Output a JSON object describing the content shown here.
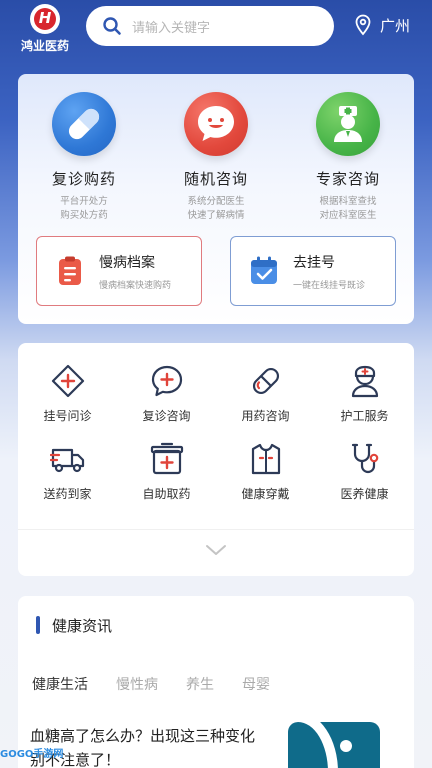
{
  "header": {
    "logo_text": "鸿业医药",
    "search_placeholder": "请输入关键字",
    "city": "广州"
  },
  "services": [
    {
      "title": "复诊购药",
      "sub1": "平台开处方",
      "sub2": "购买处方药",
      "icon": "pill-icon",
      "color": "#2f78d6"
    },
    {
      "title": "随机咨询",
      "sub1": "系统分配医生",
      "sub2": "快速了解病情",
      "icon": "chat-smile-icon",
      "color": "#e2483c"
    },
    {
      "title": "专家咨询",
      "sub1": "根据科室查找",
      "sub2": "对应科室医生",
      "icon": "doctor-icon",
      "color": "#47b448"
    }
  ],
  "quick": [
    {
      "title": "慢病档案",
      "sub": "慢病档案快速购药",
      "icon": "clipboard-icon"
    },
    {
      "title": "去挂号",
      "sub": "一键在线挂号既诊",
      "icon": "calendar-check-icon"
    }
  ],
  "grid": [
    {
      "label": "挂号问诊",
      "icon": "diamond-cross-icon"
    },
    {
      "label": "复诊咨询",
      "icon": "chat-plus-icon"
    },
    {
      "label": "用药咨询",
      "icon": "capsule-icon"
    },
    {
      "label": "护工服务",
      "icon": "nurse-icon"
    },
    {
      "label": "送药到家",
      "icon": "delivery-truck-icon"
    },
    {
      "label": "自助取药",
      "icon": "medicine-cabinet-icon"
    },
    {
      "label": "健康穿戴",
      "icon": "clothing-icon"
    },
    {
      "label": "医养健康",
      "icon": "stethoscope-icon"
    }
  ],
  "news": {
    "title": "健康资讯",
    "tabs": [
      "健康生活",
      "慢性病",
      "养生",
      "母婴"
    ],
    "article_title": "血糖高了怎么办？出现这三种变化别不注意了！"
  },
  "watermark": "GOGO手游网"
}
